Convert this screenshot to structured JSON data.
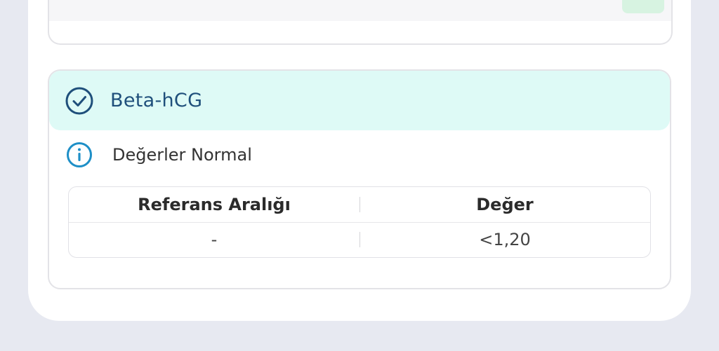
{
  "test_card": {
    "title": "Beta-hCG",
    "status_text": "Değerler Normal",
    "status_icon": "check-circle-icon",
    "info_icon": "info-circle-icon",
    "accent_color": "#1f4f7b",
    "header_bg_color": "#defaf6",
    "info_color": "#1e8fc7",
    "table": {
      "headers": [
        "Referans Aralığı",
        "Değer"
      ],
      "rows": [
        [
          "-",
          "<1,20"
        ]
      ]
    }
  }
}
